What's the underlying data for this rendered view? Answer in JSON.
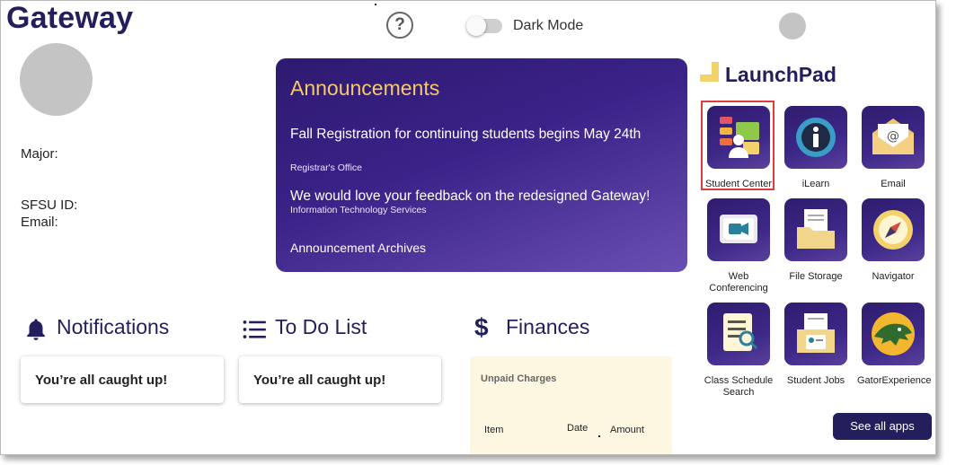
{
  "header": {
    "title": "Gateway",
    "help_symbol": "?",
    "dark_mode_label": "Dark Mode"
  },
  "profile": {
    "major_label": "Major:",
    "sfsu_id_label": "SFSU ID:",
    "email_label": "Email:"
  },
  "announcements": {
    "title": "Announcements",
    "items": [
      {
        "text": "Fall Registration for continuing students begins May 24th",
        "source": "Registrar's Office"
      },
      {
        "text": "We would love your feedback on the redesigned Gateway!",
        "source": "Information Technology Services"
      }
    ],
    "archive_link": "Announcement Archives"
  },
  "notifications": {
    "title": "Notifications",
    "message": "You’re all caught up!"
  },
  "todo": {
    "title": "To Do List",
    "message": "You’re all caught up!"
  },
  "finances": {
    "title": "Finances",
    "card_label": "Unpaid Charges",
    "columns": [
      "Item",
      "Date",
      "Amount"
    ]
  },
  "launchpad": {
    "title": "LaunchPad",
    "apps": [
      {
        "label": "Student Center",
        "icon": "student-center-icon"
      },
      {
        "label": "iLearn",
        "icon": "ilearn-icon"
      },
      {
        "label": "Email",
        "icon": "email-icon"
      },
      {
        "label": "Web Conferencing",
        "icon": "video-camera-icon"
      },
      {
        "label": "File Storage",
        "icon": "folder-icon"
      },
      {
        "label": "Navigator",
        "icon": "compass-icon"
      },
      {
        "label": "Class Schedule Search",
        "icon": "schedule-search-icon"
      },
      {
        "label": "Student Jobs",
        "icon": "student-jobs-icon"
      },
      {
        "label": "GatorExperience",
        "icon": "gator-icon"
      }
    ],
    "see_all_label": "See all apps"
  },
  "colors": {
    "brand_navy": "#231f5c",
    "announcement_purple": "#3a2288",
    "announcement_title_gold": "#f6c96b",
    "highlight_red": "#e03c3c",
    "finance_card_bg": "#fdf7e1"
  }
}
